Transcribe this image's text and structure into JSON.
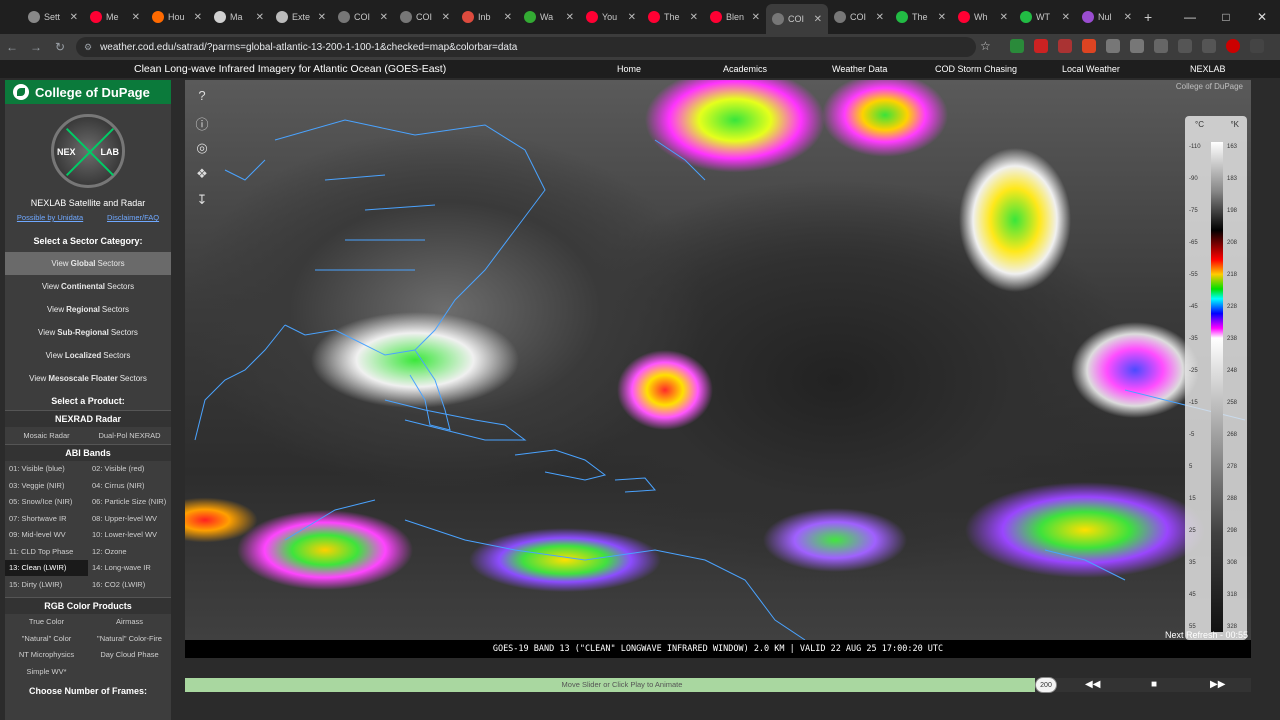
{
  "browser": {
    "tabs": [
      {
        "label": "Sett",
        "color": "#888888"
      },
      {
        "label": "Me",
        "color": "#ff0033"
      },
      {
        "label": "Hou",
        "color": "#ff6a00"
      },
      {
        "label": "Ma",
        "color": "#d0d0d0"
      },
      {
        "label": "Exte",
        "color": "#bbbbbb"
      },
      {
        "label": "COI",
        "color": "#777777"
      },
      {
        "label": "COI",
        "color": "#777777"
      },
      {
        "label": "Inb",
        "color": "#dd4b3e"
      },
      {
        "label": "Wa",
        "color": "#33aa33"
      },
      {
        "label": "You",
        "color": "#ff0033"
      },
      {
        "label": "The",
        "color": "#ff0033"
      },
      {
        "label": "Blen",
        "color": "#ff0033"
      },
      {
        "label": "COI",
        "color": "#777777",
        "active": true
      },
      {
        "label": "COI",
        "color": "#777777"
      },
      {
        "label": "The",
        "color": "#22bb44"
      },
      {
        "label": "Wh",
        "color": "#ff0033"
      },
      {
        "label": "WT",
        "color": "#22bb44"
      },
      {
        "label": "Nul",
        "color": "#9a4dd0"
      }
    ],
    "url": "weather.cod.edu/satrad/?parms=global-atlantic-13-200-1-100-1&checked=map&colorbar=data"
  },
  "header": {
    "title": "Clean Long-wave Infrared Imagery for Atlantic Ocean (GOES-East)",
    "nav": [
      "Home",
      "Academics",
      "Weather Data",
      "COD Storm Chasing",
      "Local Weather",
      "NEXLAB"
    ]
  },
  "sidebar": {
    "brand": "College of DuPage",
    "logo_left": "NEX",
    "logo_right": "LAB",
    "subtitle": "NEXLAB Satellite and Radar",
    "link1": "Possible by Unidata",
    "link2": "Disclaimer/FAQ",
    "sector_heading": "Select a Sector Category:",
    "sectors": [
      {
        "pre": "View",
        "bold": "Global",
        "post": "Sectors",
        "selected": true
      },
      {
        "pre": "View",
        "bold": "Continental",
        "post": "Sectors"
      },
      {
        "pre": "View",
        "bold": "Regional",
        "post": "Sectors"
      },
      {
        "pre": "View",
        "bold": "Sub-Regional",
        "post": "Sectors"
      },
      {
        "pre": "View",
        "bold": "Localized",
        "post": "Sectors"
      },
      {
        "pre": "View",
        "bold": "Mesoscale Floater",
        "post": "Sectors"
      }
    ],
    "product_heading": "Select a Product:",
    "nexrad_heading": "NEXRAD Radar",
    "nexrad": [
      "Mosaic Radar",
      "Dual-Pol NEXRAD"
    ],
    "abi_heading": "ABI Bands",
    "abi": [
      "01: Visible (blue)",
      "02: Visible (red)",
      "03: Veggie (NIR)",
      "04: Cirrus (NIR)",
      "05: Snow/Ice (NIR)",
      "06: Particle Size (NIR)",
      "07: Shortwave IR",
      "08: Upper-level WV",
      "09: Mid-level WV",
      "10: Lower-level WV",
      "11: CLD Top Phase",
      "12: Ozone",
      "13: Clean (LWIR)",
      "14: Long-wave IR",
      "15: Dirty (LWIR)",
      "16: CO2 (LWIR)"
    ],
    "abi_selected_index": 12,
    "rgb_heading": "RGB Color Products",
    "rgb": [
      "True Color",
      "Airmass",
      "\"Natural\" Color",
      "\"Natural\" Color-Fire",
      "NT Microphysics",
      "Day Cloud Phase",
      "Simple WV*"
    ],
    "frames_heading": "Choose Number of Frames:"
  },
  "map": {
    "watermark": "College of DuPage",
    "colorbar": {
      "unit_c": "°C",
      "unit_k": "°K",
      "left_ticks": [
        "-110",
        "-90",
        "-75",
        "-65",
        "-55",
        "-45",
        "-35",
        "-25",
        "-15",
        "-5",
        "5",
        "15",
        "25",
        "35",
        "45",
        "55"
      ],
      "right_ticks": [
        "163",
        "183",
        "198",
        "208",
        "218",
        "228",
        "238",
        "248",
        "258",
        "268",
        "278",
        "288",
        "298",
        "308",
        "318",
        "328"
      ]
    }
  },
  "caption": "GOES-19 BAND 13 (\"CLEAN\" LONGWAVE INFRARED WINDOW) 2.0 KM | VALID 22 AUG 25 17:00:20 UTC",
  "refresh": "Next Refresh - 00:55",
  "slider": {
    "label": "Move Slider or Click Play to Animate",
    "thumb_value": "200"
  }
}
